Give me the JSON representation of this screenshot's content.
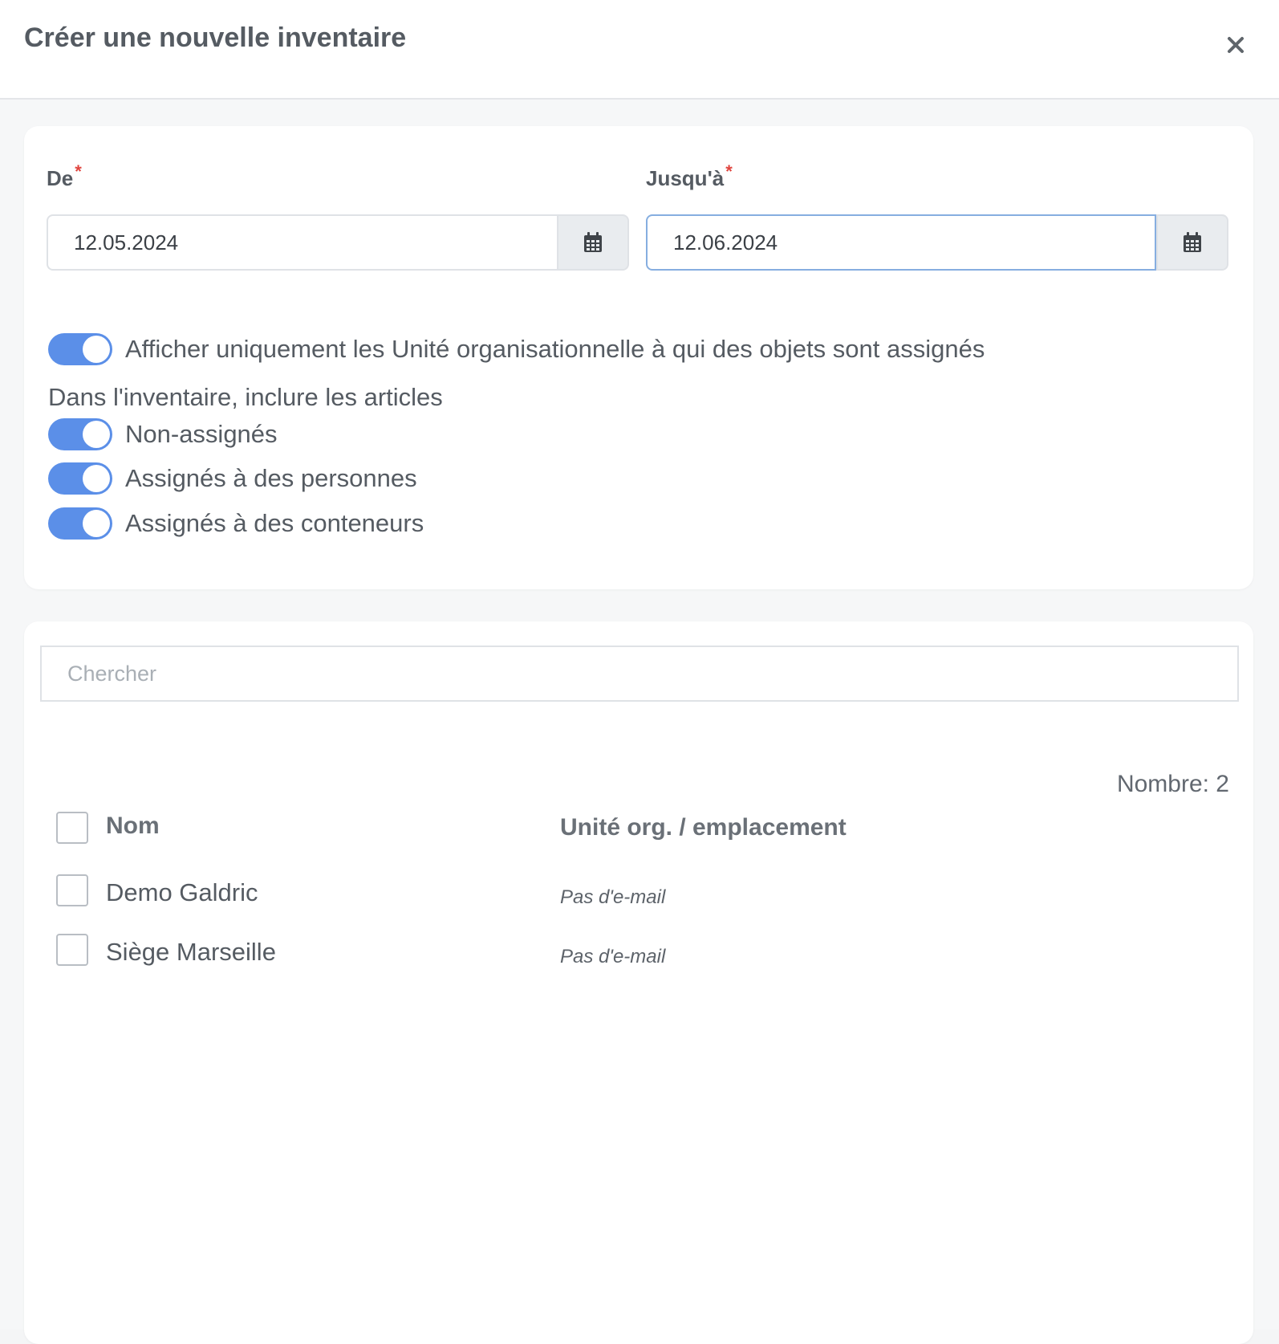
{
  "header": {
    "title": "Créer une nouvelle inventaire"
  },
  "dates": {
    "from_label": "De",
    "from_value": "12.05.2024",
    "to_label": "Jusqu'à",
    "to_value": "12.06.2024",
    "required_mark": "*"
  },
  "options": {
    "only_assigned_label": "Afficher uniquement les Unité organisationnelle à qui des objets sont assignés",
    "include_heading": "Dans l'inventaire, inclure les articles",
    "non_assigned_label": "Non-assignés",
    "assigned_persons_label": "Assignés à des personnes",
    "assigned_containers_label": "Assignés à des conteneurs",
    "only_assigned_on": true,
    "non_assigned_on": true,
    "assigned_persons_on": true,
    "assigned_containers_on": true
  },
  "list": {
    "search_placeholder": "Chercher",
    "count_text": "Nombre: 2",
    "columns": {
      "name": "Nom",
      "org": "Unité org. / emplacement"
    },
    "rows": [
      {
        "name": "Demo Galdric",
        "org": "Pas d'e-mail"
      },
      {
        "name": "Siège Marseille",
        "org": "Pas d'e-mail"
      }
    ]
  },
  "colors": {
    "toggle_on": "#5b8fe8",
    "required": "#e0443e",
    "focus_border": "#86aee0"
  }
}
